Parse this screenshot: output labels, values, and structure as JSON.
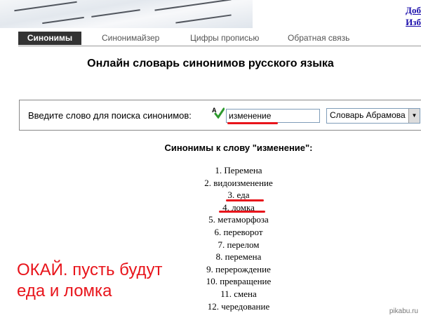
{
  "corner_links": [
    "Доб",
    "Изб"
  ],
  "nav": [
    "Синонимы",
    "Синонимайзер",
    "Цифры прописью",
    "Обратная связь"
  ],
  "page_title": "Онлайн словарь синонимов русского языка",
  "search": {
    "label": "Введите слово для поиска синонимов:",
    "value": "изменение",
    "dictionary": "Словарь Абрамова"
  },
  "synonyms_heading": "Синонимы к слову \"изменение\":",
  "synonyms": [
    "1. Перемена",
    "2. видоизменение",
    "3. еда",
    "4. ломка",
    "5. метаморфоза",
    "6. переворот",
    "7. перелом",
    "8. перемена",
    "9. перерождение",
    "10. превращение",
    "11. смена",
    "12. чередование"
  ],
  "annotation": [
    "ОКАЙ. пусть будут",
    "еда и ломка"
  ],
  "watermark": "pikabu.ru",
  "colors": {
    "nav_active_bg": "#333333",
    "annotation": "#e8141b",
    "link": "#1a0dab"
  }
}
